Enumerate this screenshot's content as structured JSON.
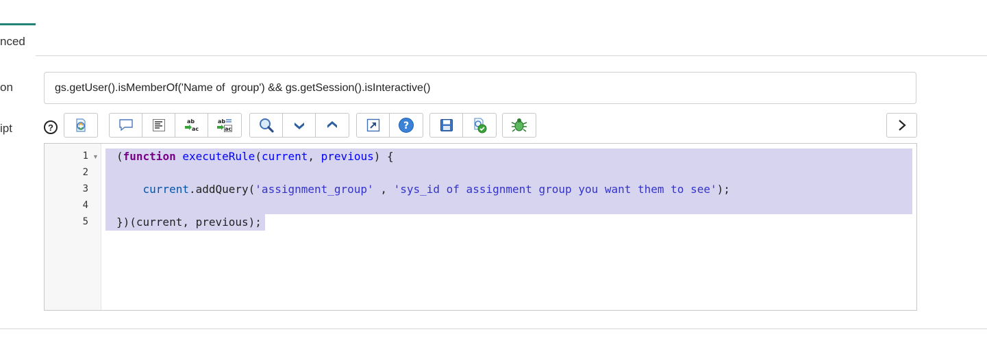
{
  "tab": {
    "label": "nced"
  },
  "condition": {
    "label": "on",
    "value": "gs.getUser().isMemberOf('Name of  group') && gs.getSession().isInteractive()"
  },
  "script": {
    "label": "ipt",
    "help_glyph": "?",
    "lines": [
      {
        "num": "1"
      },
      {
        "num": "2"
      },
      {
        "num": "3"
      },
      {
        "num": "4"
      },
      {
        "num": "5"
      }
    ],
    "code": {
      "l1": {
        "open": "(",
        "kw": "function",
        "sp": " ",
        "fn": "executeRule",
        "p1": "(",
        "a1": "current",
        "c": ", ",
        "a2": "previous",
        "end": ") {"
      },
      "l3": {
        "indent": "    ",
        "obj": "current",
        "call": ".addQuery(",
        "s1": "'assignment_group'",
        "mid": " , ",
        "s2": "'sys_id of assignment group you want them to see'",
        "end": ");"
      },
      "l5": {
        "text": "})(current, previous);"
      }
    }
  },
  "toolbar": {
    "icons": [
      "script-include-icon",
      "comment-icon",
      "format-icon",
      "replace-icon",
      "replace-all-icon",
      "search-icon",
      "next-icon",
      "previous-icon",
      "fullscreen-icon",
      "help-icon",
      "save-icon",
      "check-syntax-icon",
      "debug-icon",
      "expand-icon"
    ]
  }
}
